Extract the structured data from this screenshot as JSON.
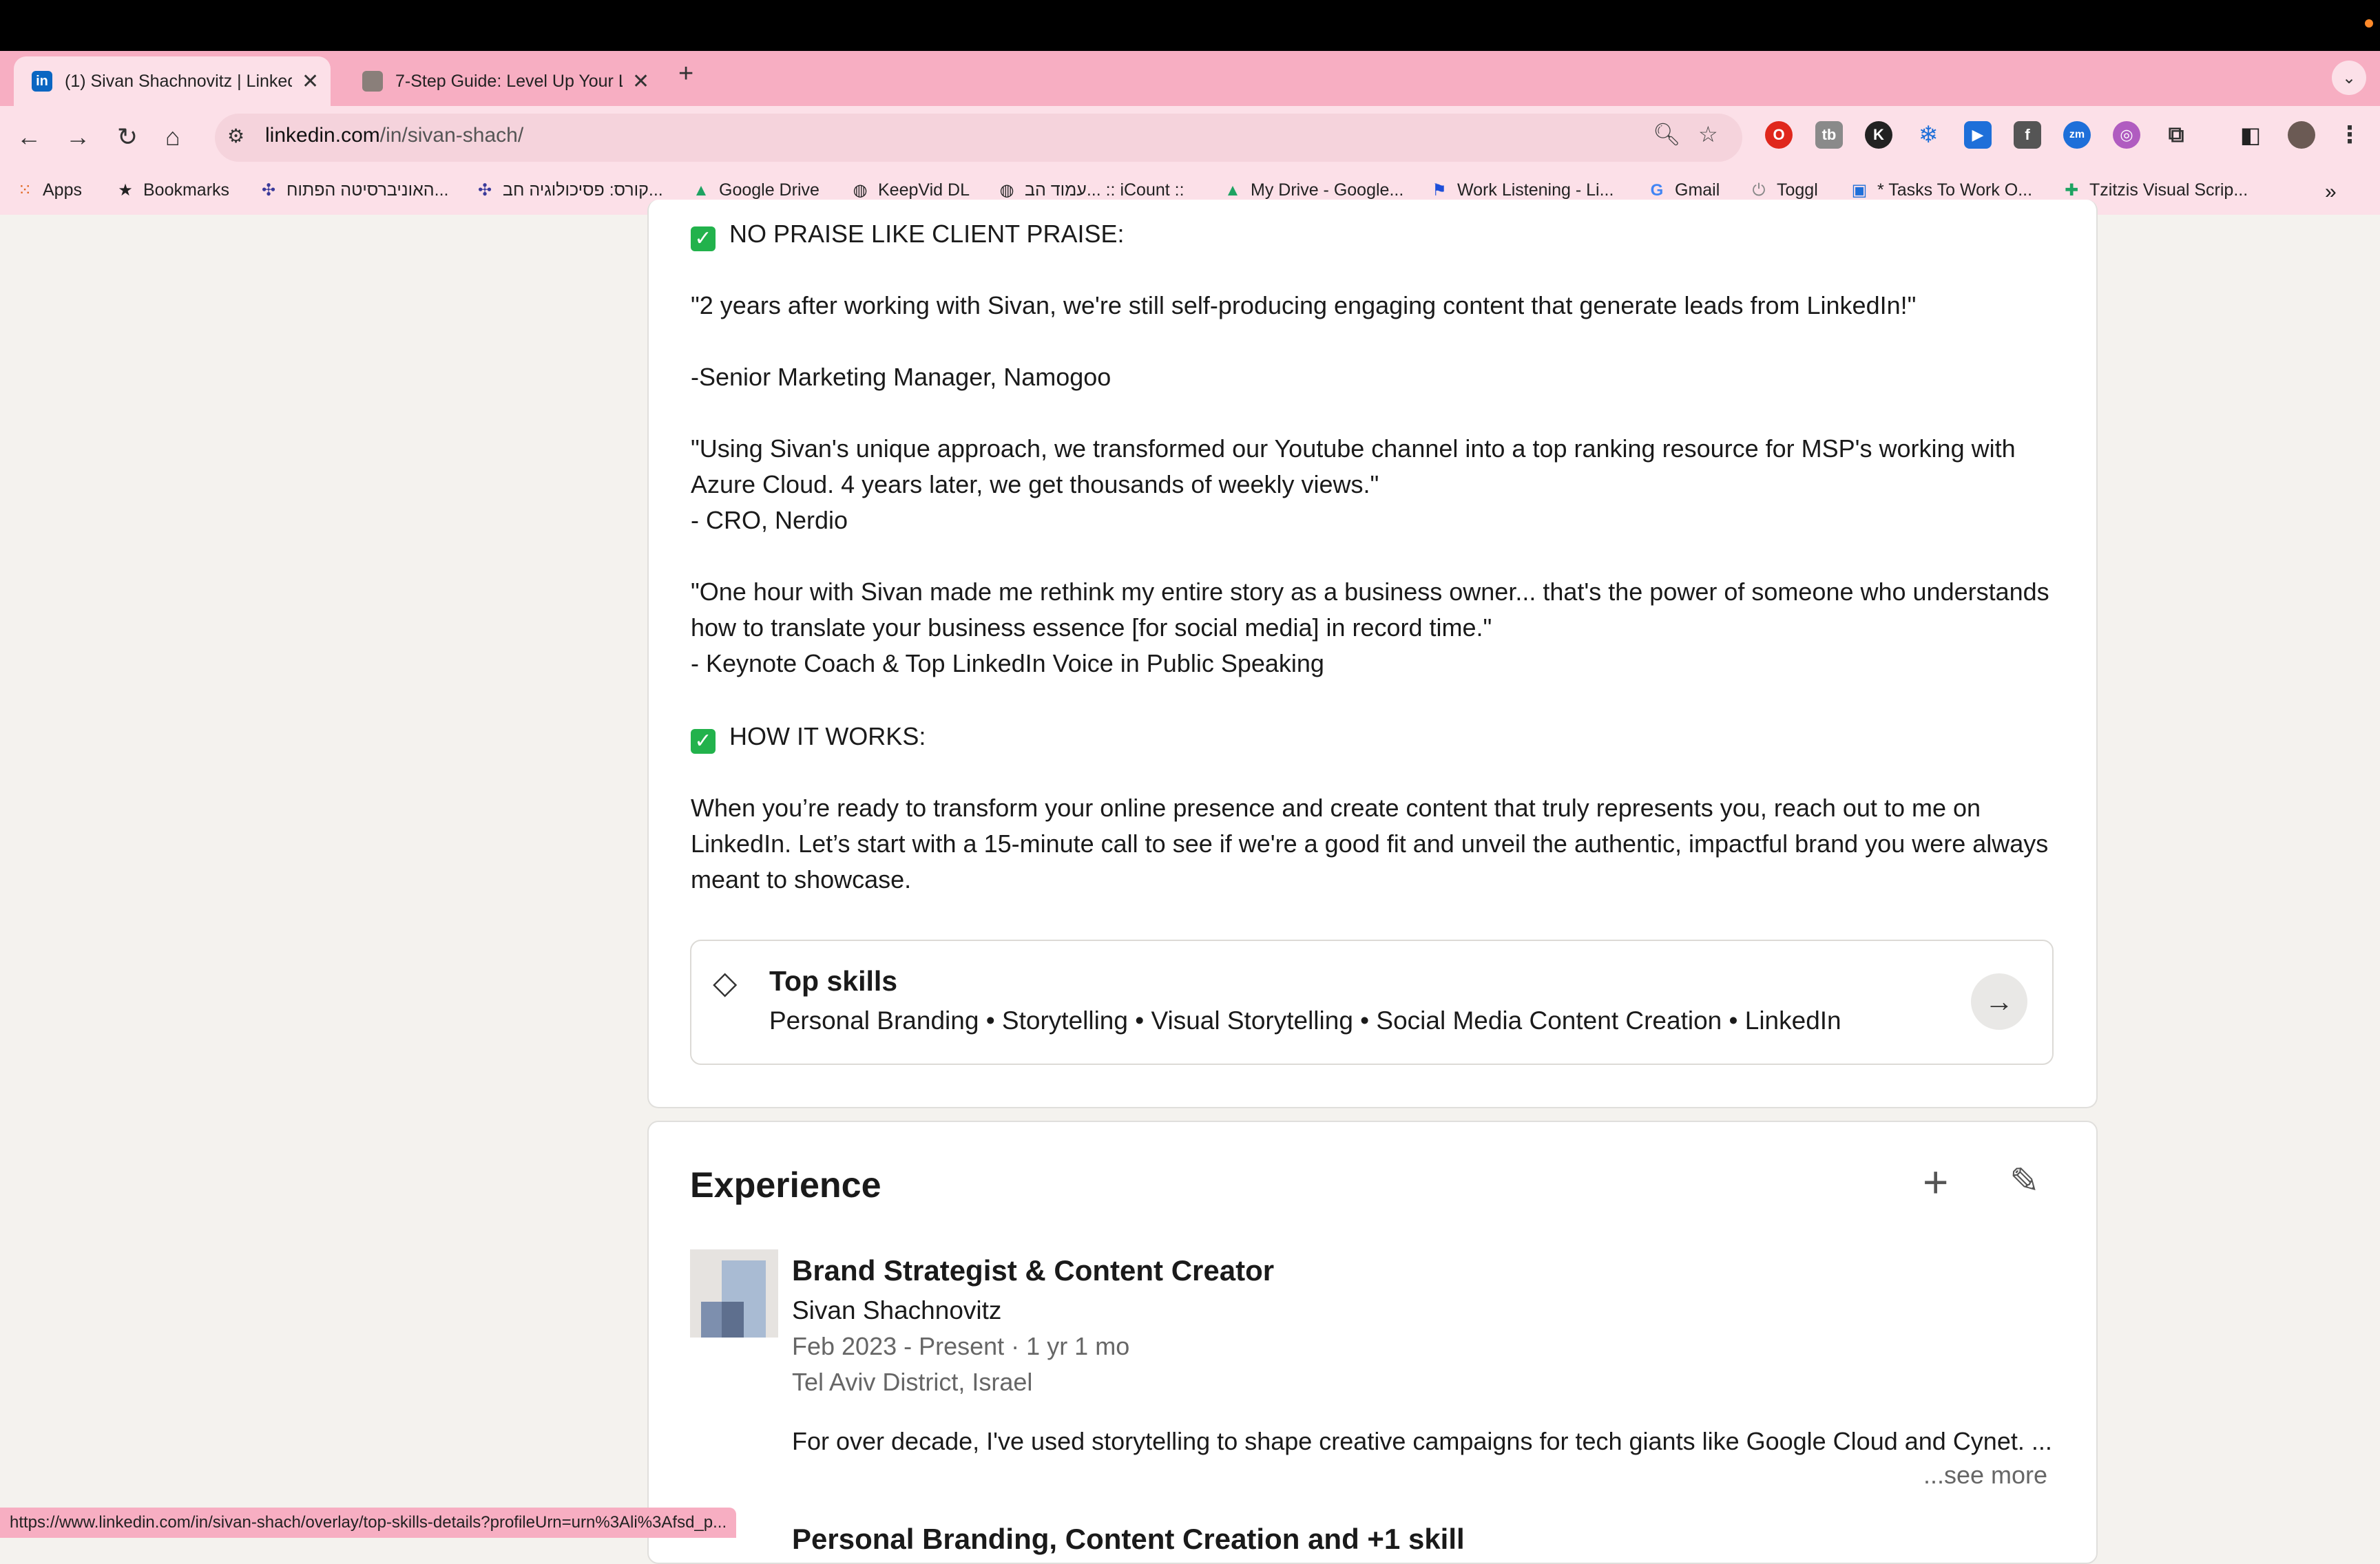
{
  "browser": {
    "tabs": [
      {
        "title": "(1) Sivan Shachnovitz | Linked",
        "active": true
      },
      {
        "title": "7-Step Guide: Level Up Your L",
        "active": false
      }
    ],
    "new_tab": "+",
    "url_domain": "linkedin.com",
    "url_path": "/in/sivan-shach/",
    "bookmarks": [
      {
        "label": "Apps",
        "icon": "apps-grid-icon"
      },
      {
        "label": "Bookmarks",
        "icon": "star-icon"
      },
      {
        "label": "האוניברסיטה הפתוח...",
        "icon": "network-icon"
      },
      {
        "label": "קורס: פסיכולוגיה חב...",
        "icon": "network-icon"
      },
      {
        "label": "Google Drive",
        "icon": "drive-icon"
      },
      {
        "label": "KeepVid DL",
        "icon": "globe-icon"
      },
      {
        "label": "עמוד הב... :: iCount ::",
        "icon": "globe-icon"
      },
      {
        "label": "My Drive - Google...",
        "icon": "drive-icon"
      },
      {
        "label": "Work Listening - Li...",
        "icon": "flag-icon"
      },
      {
        "label": "Gmail",
        "icon": "google-icon"
      },
      {
        "label": "Toggl",
        "icon": "power-icon"
      },
      {
        "label": "* Tasks To Work O...",
        "icon": "tasks-icon"
      },
      {
        "label": "Tzitzis Visual Scrip...",
        "icon": "plus-sheet-icon"
      }
    ],
    "status_url": "https://www.linkedin.com/in/sivan-shach/overlay/top-skills-details?profileUrn=urn%3Ali%3Afsd_p..."
  },
  "about": {
    "praise_heading": "NO PRAISE LIKE CLIENT PRAISE:",
    "quote1": "\"2 years after working with Sivan, we're still self-producing engaging content that generate leads from LinkedIn!\"",
    "quote1_author": "-Senior Marketing Manager, Namogoo",
    "quote2": "\"Using Sivan's unique approach, we transformed our Youtube channel into a top ranking resource for MSP's working with Azure Cloud. 4 years later, we get thousands of weekly views.\"",
    "quote2_author": "- CRO, Nerdio",
    "quote3": "\"One hour with Sivan made me rethink my entire story as a business owner... that's the power of someone who understands how to translate your business essence [for social media] in record time.\"",
    "quote3_author": "- Keynote Coach & Top LinkedIn Voice in Public Speaking",
    "how_heading": "HOW IT WORKS:",
    "how_text": "When you’re ready to transform your online presence and create content that truly represents you, reach out to me on LinkedIn. Let’s start with a 15-minute call to see if we're a good fit and unveil the authentic, impactful brand you were always meant to showcase."
  },
  "top_skills": {
    "title": "Top skills",
    "list": "Personal Branding • Storytelling • Visual Storytelling • Social Media Content Creation • LinkedIn"
  },
  "experience": {
    "title": "Experience",
    "role": "Brand Strategist & Content Creator",
    "company": "Sivan Shachnovitz",
    "dates": "Feb 2023 - Present · 1 yr 1 mo",
    "location": "Tel Aviv District, Israel",
    "description": "For over decade, I've used storytelling to shape creative campaigns for tech giants like Google Cloud and Cynet. ...",
    "see_more": "...see more",
    "next_role": "Personal Branding, Content Creation and +1 skill"
  },
  "colors": {
    "tab_strip": "#f7aec2",
    "toolbar": "#fce0e8",
    "page_bg": "#f4f2ee",
    "check_green": "#22b24c"
  }
}
